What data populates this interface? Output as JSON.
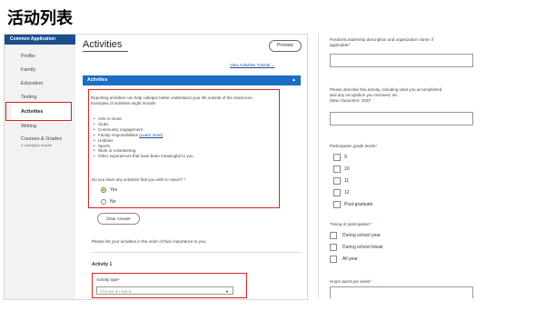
{
  "slide_title": "活动列表",
  "sidebar": {
    "header": "Common Application",
    "items": [
      {
        "label": "Profile"
      },
      {
        "label": "Family"
      },
      {
        "label": "Education"
      },
      {
        "label": "Testing"
      },
      {
        "label": "Activities"
      },
      {
        "label": "Writing"
      },
      {
        "label": "Courses & Grades"
      }
    ],
    "courses_sub": "4 college(s) require"
  },
  "main": {
    "page_title": "Activities",
    "preview_label": "Preview",
    "tutorial_link": "View Activities Tutorial",
    "section_bar": "Activities",
    "intro": "Reporting activities can help colleges better understand your life outside of the classroom. Examples of activities might include:",
    "examples": [
      "Arts or music",
      "Clubs",
      "Community engagement",
      "Family responsibilities",
      "Hobbies",
      "Sports",
      "Work or volunteering",
      "Other experiences that have been meaningful to you"
    ],
    "learn_more": "(Learn more)",
    "question": "Do you have any activities that you wish to report?",
    "options": [
      "Yes",
      "No"
    ],
    "selected_option": "Yes",
    "clear_label": "Clear Answer",
    "list_prompt": "Please list your activities in the order of their importance to you.",
    "activity_heading": "Activity 1",
    "activity_type_label": "Activity type",
    "activity_type_placeholder": "Choose an option"
  },
  "right": {
    "position_label_1": "Position/Leadership description and organization name, if",
    "position_label_2": "applicable",
    "describe_1": "Please describe this activity, including what you accomplished",
    "describe_2": "and any recognition you received, etc.",
    "describe_3": "(Max characters: 150)",
    "grade_label": "Participation grade levels",
    "grades": [
      "9",
      "10",
      "11",
      "12",
      "Post-graduate"
    ],
    "timing_label": "Timing of participation",
    "timing": [
      "During school year",
      "During school break",
      "All year"
    ],
    "hours_label": "Hours spent per week"
  },
  "colors": {
    "accent": "#1b6ec2",
    "sidebar_header": "#1b4f8c",
    "highlight": "#e02020",
    "radio_selected": "#4a8c1f"
  },
  "icons": {
    "caret": "chevron-up-icon",
    "select_arrow": "triangle-down-icon"
  }
}
